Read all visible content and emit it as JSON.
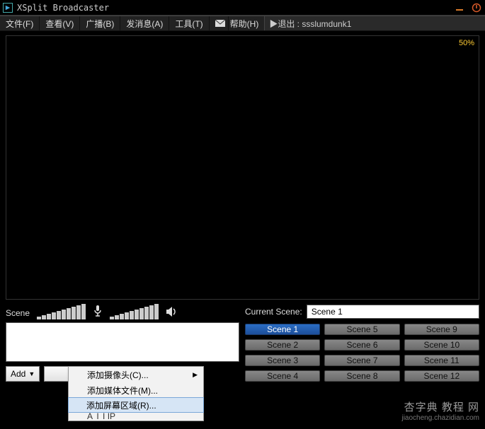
{
  "titlebar": {
    "app_name": "XSplit Broadcaster"
  },
  "menubar": {
    "file": "文件(F)",
    "view": "查看(V)",
    "broadcast": "广播(B)",
    "message": "发消息(A)",
    "tools": "工具(T)",
    "help": "帮助(H)",
    "exit_label": "▶退出 : ssslumdunk1"
  },
  "preview": {
    "zoom": "50%"
  },
  "left_panel": {
    "scene_label": "Scene",
    "add_label": "Add"
  },
  "right_panel": {
    "current_scene_label": "Current Scene:",
    "current_scene_value": "Scene 1",
    "scenes": {
      "s1": "Scene 1",
      "s2": "Scene 2",
      "s3": "Scene 3",
      "s4": "Scene 4",
      "s5": "Scene 5",
      "s6": "Scene 6",
      "s7": "Scene 7",
      "s8": "Scene 8",
      "s9": "Scene 9",
      "s10": "Scene 10",
      "s11": "Scene 11",
      "s12": "Scene 12"
    }
  },
  "context_menu": {
    "add_camera": "添加摄像头(C)...",
    "add_media": "添加媒体文件(M)...",
    "add_screen": "添加屏幕区域(R)...",
    "add_ip_partial": "A  I I IP"
  },
  "watermark": {
    "line1": "杏字典 教程 网",
    "line2": "jiaocheng.chazidian.com"
  }
}
